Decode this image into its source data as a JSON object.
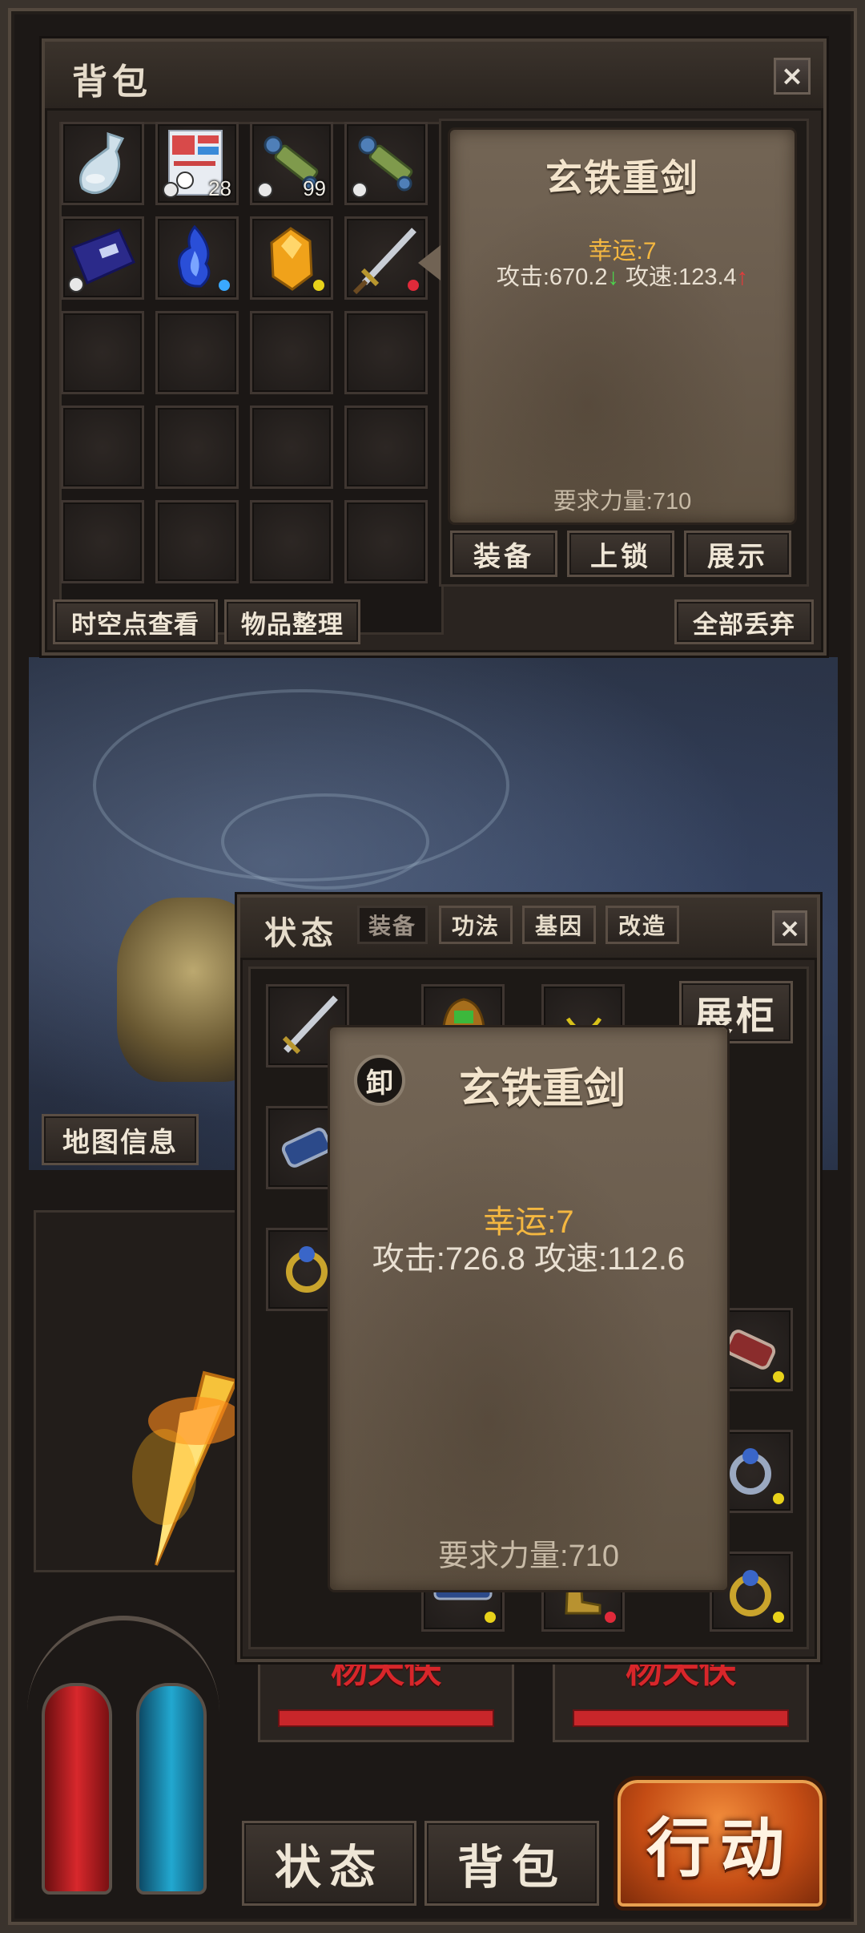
{
  "bag": {
    "title": "背包",
    "close_label": "×",
    "slots": [
      {
        "icon": "bottle-icon",
        "count": ""
      },
      {
        "icon": "scroll-pack-icon",
        "count": "28"
      },
      {
        "icon": "green-scroll-icon",
        "count": "99"
      },
      {
        "icon": "green-scroll-icon",
        "count": ""
      },
      {
        "icon": "blue-book-icon",
        "count": ""
      },
      {
        "icon": "blue-flame-icon",
        "count": ""
      },
      {
        "icon": "amber-crystal-icon",
        "count": ""
      },
      {
        "icon": "sword-icon",
        "count": ""
      }
    ],
    "buttons": {
      "view_spacetime": "时空点查看",
      "sort_items": "物品整理",
      "discard_all": "全部丢弃"
    },
    "tooltip": {
      "name": "玄铁重剑",
      "luck": "幸运:7",
      "attack": "攻击:670.2",
      "attack_arrow": "↓",
      "speed": "攻速:123.4",
      "speed_arrow": "↑",
      "requirement": "要求力量:710",
      "equip_label": "装备",
      "lock_label": "上锁",
      "show_label": "展示"
    }
  },
  "status": {
    "title": "状态",
    "close_label": "×",
    "tabs": [
      "装备",
      "功法",
      "基因",
      "改造"
    ],
    "display_cabinet": "展柜",
    "tooltip": {
      "unequip_badge": "卸",
      "name": "玄铁重剑",
      "luck": "幸运:7",
      "stats": "攻击:726.8 攻速:112.6",
      "requirement": "要求力量:710"
    }
  },
  "map_info": "地图信息",
  "targets": [
    "杨天佚",
    "杨天佚"
  ],
  "bottom_nav": {
    "status": "状态",
    "bag": "背包",
    "action": "行动"
  },
  "colors": {
    "luck": "#f4b740",
    "arrow_down": "#4cd64c",
    "arrow_up": "#e23b3b",
    "hp": "#c8262a",
    "mp": "#1e9cc4",
    "action_button": "#d4541b"
  }
}
